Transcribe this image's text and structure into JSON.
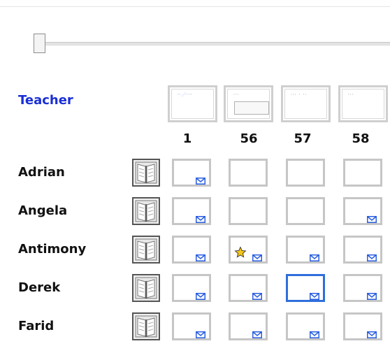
{
  "slider": {
    "value_fraction": 0.0
  },
  "teacher": {
    "label": "Teacher"
  },
  "columns": [
    {
      "number": "1"
    },
    {
      "number": "56"
    },
    {
      "number": "57"
    },
    {
      "number": "58"
    }
  ],
  "students": [
    {
      "name": "Adrian",
      "cells": [
        "mail",
        "empty",
        "empty",
        "empty"
      ]
    },
    {
      "name": "Angela",
      "cells": [
        "mail",
        "empty",
        "empty",
        "mail"
      ]
    },
    {
      "name": "Antimony",
      "cells": [
        "mail",
        "star-mail",
        "mail",
        "mail"
      ]
    },
    {
      "name": "Derek",
      "cells": [
        "mail",
        "mail",
        "mail-selected",
        "mail"
      ]
    },
    {
      "name": "Farid",
      "cells": [
        "mail",
        "mail",
        "mail",
        "mail"
      ]
    }
  ],
  "icons": {
    "book": "open-book-icon",
    "mail": "mail-icon",
    "star": "star-icon"
  },
  "colors": {
    "teacher_label": "#1a2fd6",
    "mail_icon": "#2b5fe0",
    "selected_border": "#2f6fdb",
    "star_fill": "#f5c518"
  }
}
